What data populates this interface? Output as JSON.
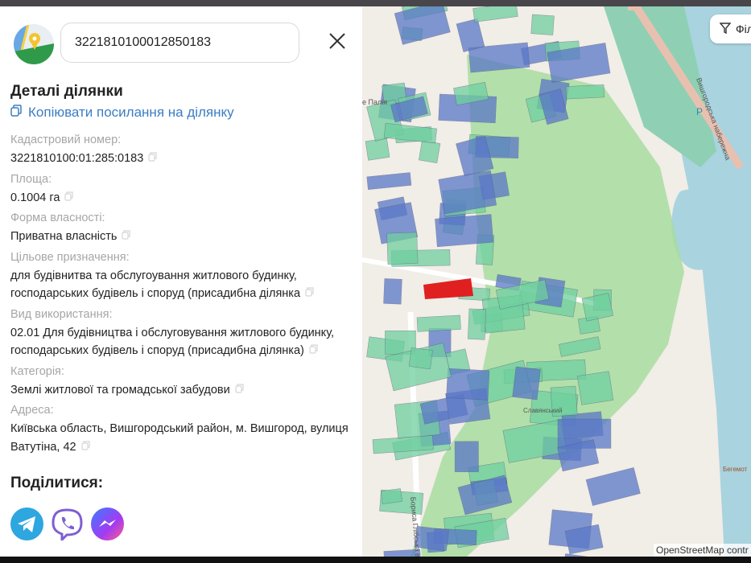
{
  "search": {
    "value": "3221810100012850183"
  },
  "details": {
    "title": "Деталі ділянки",
    "copy_link": "Копіювати посилання на ділянку",
    "fields": [
      {
        "label": "Кадастровий номер:",
        "value": "3221810100:01:285:0183"
      },
      {
        "label": "Площа:",
        "value": "0.1004 га"
      },
      {
        "label": "Форма власності:",
        "value": "Приватна власність"
      },
      {
        "label": "Цільове призначення:",
        "value": "для будівнитва та обслугоування житлового будинку, господарських будівель і споруд (присадибна ділянка"
      },
      {
        "label": "Вид використання:",
        "value": "02.01 Для будівництва і обслуговування житлового будинку, господарських будівель і споруд (присадибна ділянка)"
      },
      {
        "label": "Категорія:",
        "value": "Землі житлової та громадської забудови"
      },
      {
        "label": "Адреса:",
        "value": "Київська область, Вишгородський район, м. Вишгород, вулиця Ватутіна, 42"
      }
    ]
  },
  "share": {
    "title": "Поділитися:",
    "icons": [
      "telegram-icon",
      "viber-icon",
      "messenger-icon"
    ]
  },
  "map": {
    "filter_label": "Філ",
    "attribution": "OpenStreetMap contr",
    "labels": {
      "street1": "Вишгородська набережна",
      "street2": "Бориса Глібська вул",
      "street3": "е Палія",
      "poi1": "Славянський",
      "poi2": "Бегемот",
      "parking": "P"
    },
    "colors": {
      "parcel_green": "#6fcf9f",
      "parcel_blue": "#5a78c8",
      "selected": "#e02020",
      "water": "#a9d3df"
    }
  }
}
